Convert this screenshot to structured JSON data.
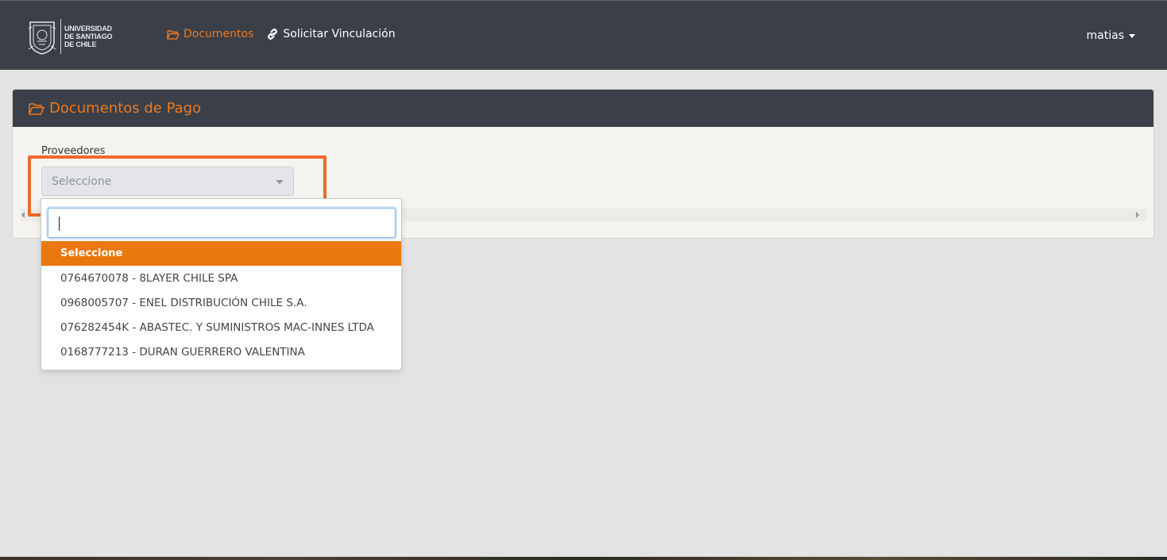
{
  "header": {
    "logo_lines": [
      "UNIVERSIDAD",
      "DE SANTIAGO",
      "DE CHILE"
    ],
    "nav": [
      {
        "label": "Documentos",
        "icon": "folder-open-icon",
        "active": true
      },
      {
        "label": "Solicitar Vinculación",
        "icon": "link-icon",
        "active": false
      }
    ],
    "user": {
      "name": "matias"
    }
  },
  "card": {
    "title": "Documentos de Pago",
    "title_icon": "folder-open-icon",
    "field_label": "Proveedores",
    "select_value": "Seleccione"
  },
  "dropdown": {
    "search_value": "",
    "options": [
      {
        "label": "Seleccione",
        "selected": true
      },
      {
        "label": "0764670078 - 8LAYER CHILE SPA",
        "selected": false
      },
      {
        "label": "0968005707 - ENEL DISTRIBUCIÓN CHILE S.A.",
        "selected": false
      },
      {
        "label": "076282454K - ABASTEC. Y SUMINISTROS MAC-INNES LTDA",
        "selected": false
      },
      {
        "label": "0168777213 - DURAN GUERRERO VALENTINA",
        "selected": false
      }
    ]
  },
  "colors": {
    "accent": "#ec7a1f",
    "header_bg": "#3a3f48",
    "highlight_border": "#ec6a2c"
  }
}
